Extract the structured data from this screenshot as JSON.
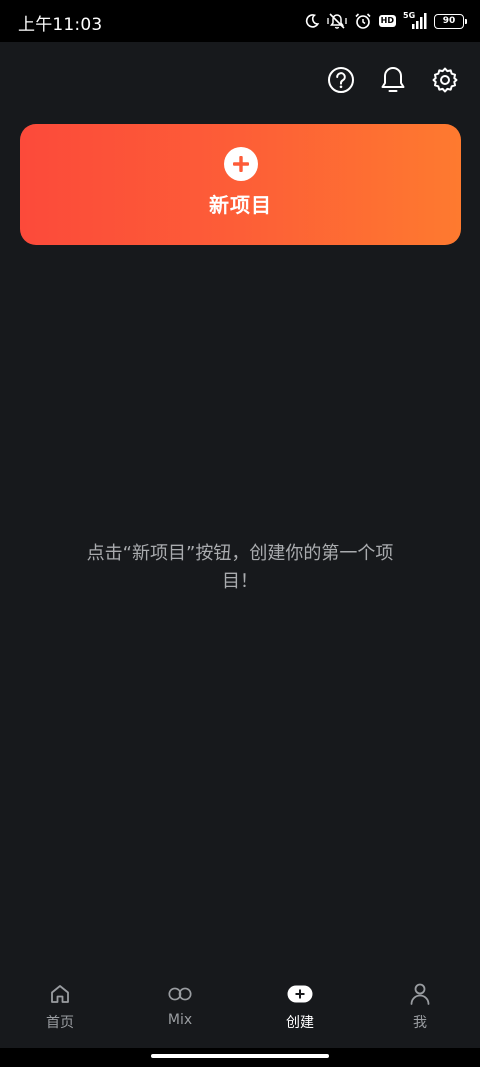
{
  "status_bar": {
    "time": "上午11:03",
    "icons": [
      "moon-icon",
      "mute-vibrate-icon",
      "alarm-icon",
      "hd-badge",
      "signal-5g-icon",
      "battery-icon"
    ],
    "hd": "HD",
    "network": "5G",
    "battery": "90"
  },
  "top_actions": {
    "icons": [
      "help-icon",
      "bell-icon",
      "gear-icon"
    ]
  },
  "new_project": {
    "label": "新项目",
    "icon": "plus-circle-icon",
    "gradient_start": "#fc4a3a",
    "gradient_end": "#fe7a2f"
  },
  "empty_hint": {
    "line1": "点击“新项目”按钮，创建你的第一个项",
    "line2": "目！"
  },
  "bottom_nav": {
    "items": [
      {
        "label": "首页",
        "icon": "home-icon",
        "active": false
      },
      {
        "label": "Mix",
        "icon": "infinity-icon",
        "active": false
      },
      {
        "label": "创建",
        "icon": "add-pill-icon",
        "active": true
      },
      {
        "label": "我",
        "icon": "person-icon",
        "active": false
      }
    ]
  },
  "colors": {
    "background": "#17191c",
    "status_bar": "#000000",
    "text_muted": "#a9abae",
    "nav_inactive": "#9a9da1",
    "nav_active": "#ffffff"
  }
}
